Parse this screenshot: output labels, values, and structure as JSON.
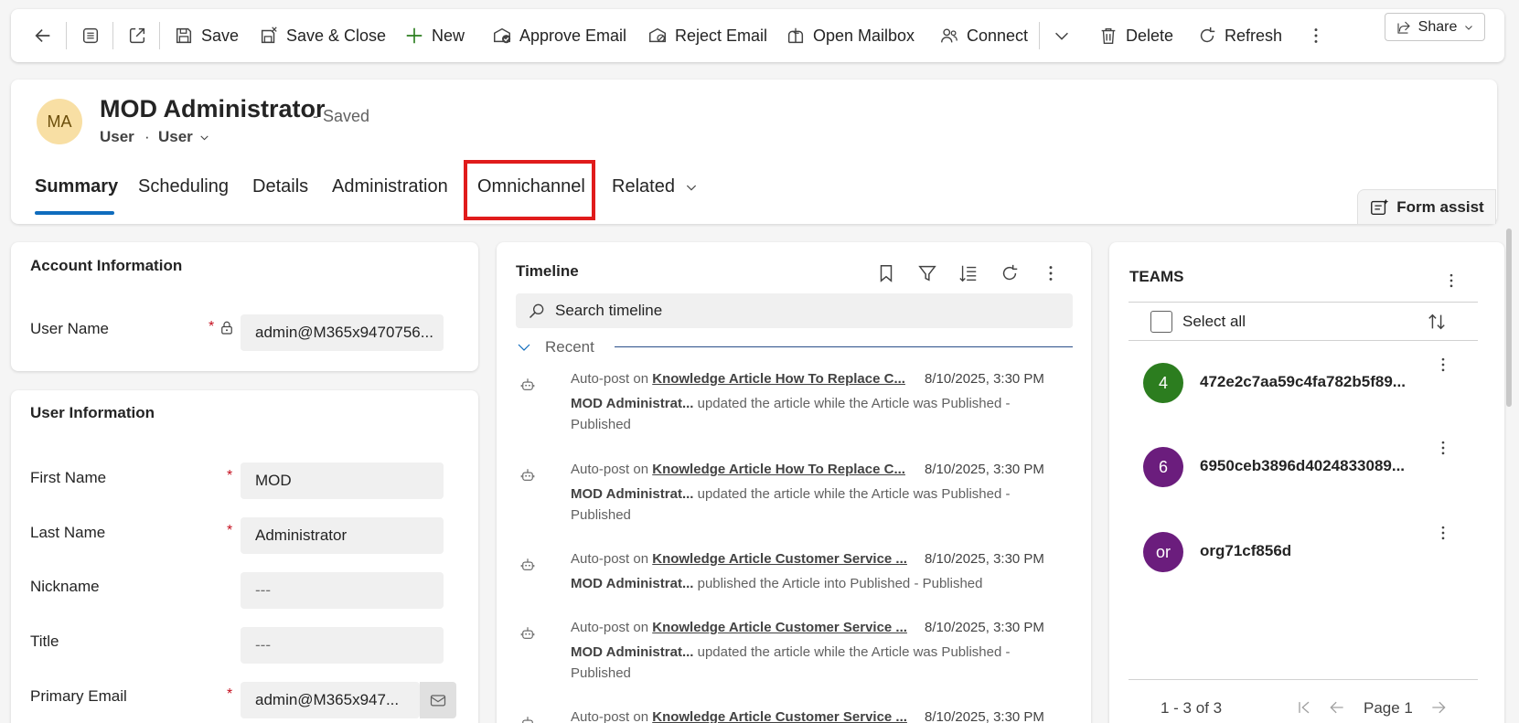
{
  "toolbar": {
    "save": "Save",
    "save_close": "Save & Close",
    "new": "New",
    "approve_email": "Approve Email",
    "reject_email": "Reject Email",
    "open_mailbox": "Open Mailbox",
    "connect": "Connect",
    "delete": "Delete",
    "refresh": "Refresh",
    "share": "Share"
  },
  "header": {
    "avatar_initials": "MA",
    "title": "MOD Administrator",
    "status": "- Saved",
    "entity": "User",
    "separator": "·",
    "form_selector": "User",
    "form_assist": "Form assist"
  },
  "tabs": [
    "Summary",
    "Scheduling",
    "Details",
    "Administration",
    "Omnichannel",
    "Related"
  ],
  "account_info": {
    "title": "Account Information",
    "user_name_label": "User Name",
    "user_name_value": "admin@M365x9470756..."
  },
  "user_info": {
    "title": "User Information",
    "fields": [
      {
        "label": "First Name",
        "value": "MOD",
        "required": "*"
      },
      {
        "label": "Last Name",
        "value": "Administrator",
        "required": "*"
      },
      {
        "label": "Nickname",
        "value": "---",
        "required": ""
      },
      {
        "label": "Title",
        "value": "---",
        "required": ""
      },
      {
        "label": "Primary Email",
        "value": "admin@M365x947...",
        "required": "*"
      }
    ]
  },
  "timeline": {
    "title": "Timeline",
    "search_placeholder": "Search timeline",
    "group": "Recent",
    "items": [
      {
        "prefix": "Auto-post on ",
        "link": "Knowledge Article How To Replace C...",
        "date": "8/10/2025, 3:30 PM",
        "author": "MOD Administrat...",
        "text": " updated the article while the Article was Published - Published"
      },
      {
        "prefix": "Auto-post on ",
        "link": "Knowledge Article How To Replace C...",
        "date": "8/10/2025, 3:30 PM",
        "author": "MOD Administrat...",
        "text": " updated the article while the Article was Published - Published"
      },
      {
        "prefix": "Auto-post on ",
        "link": "Knowledge Article Customer Service ...",
        "date": "8/10/2025, 3:30 PM",
        "author": "MOD Administrat...",
        "text": " published the Article into Published - Published"
      },
      {
        "prefix": "Auto-post on ",
        "link": "Knowledge Article Customer Service ...",
        "date": "8/10/2025, 3:30 PM",
        "author": "MOD Administrat...",
        "text": " updated the article while the Article was Published - Published"
      },
      {
        "prefix": "Auto-post on ",
        "link": "Knowledge Article Customer Service ...",
        "date": "8/10/2025, 3:30 PM",
        "author": "",
        "text": ""
      }
    ]
  },
  "teams": {
    "title": "TEAMS",
    "select_all": "Select all",
    "rows": [
      {
        "initial": "4",
        "name": "472e2c7aa59c4fa782b5f89...",
        "color": "#2c7d1f"
      },
      {
        "initial": "6",
        "name": "6950ceb3896d4024833089...",
        "color": "#6b1d7d"
      },
      {
        "initial": "or",
        "name": "org71cf856d",
        "color": "#6b1d7d"
      }
    ],
    "pager_count": "1 - 3 of 3",
    "pager_page": "Page 1"
  },
  "colors": {
    "accent": "#0f6cbd",
    "highlight": "#e01b1b",
    "required": "#c50f1f"
  }
}
